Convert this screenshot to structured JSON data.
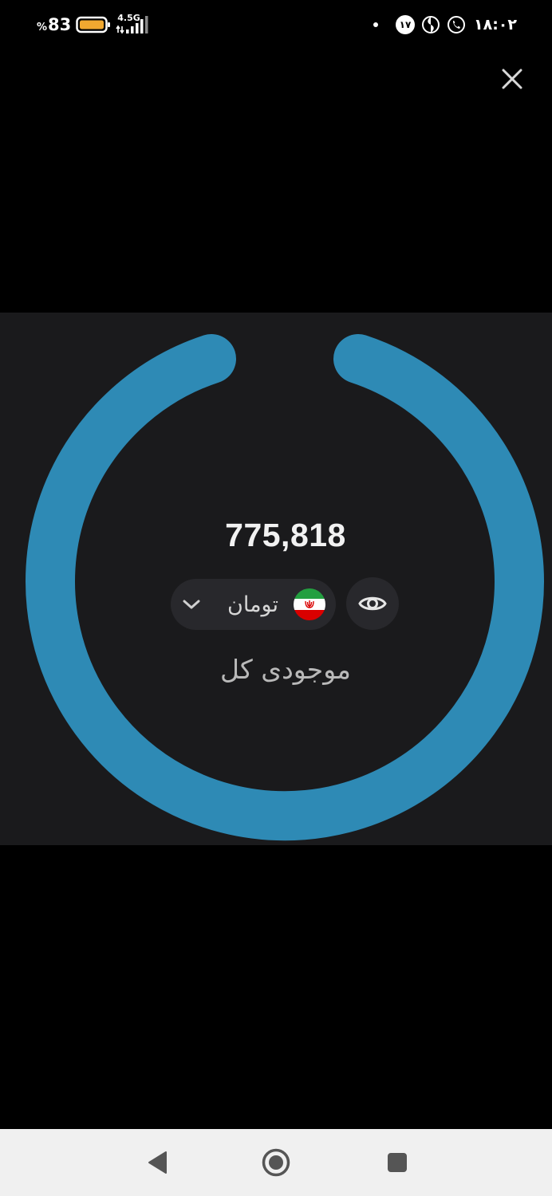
{
  "status_bar": {
    "battery_percent": "83",
    "percent_sign": "%",
    "network_type": "4.5G",
    "notification_count": "۱۷",
    "time": "۱۸:۰۲",
    "battery_color": "#f0a830"
  },
  "close_button": {
    "icon": "close-icon"
  },
  "wallet": {
    "balance": "775,818",
    "currency": "تومان",
    "currency_flag": "iran-flag-icon",
    "caption": "موجودی کل",
    "ring_color": "#2e8ab5",
    "visibility_icon": "eye-icon"
  },
  "navigation": {
    "back_icon": "back-icon",
    "home_icon": "home-icon",
    "recents_icon": "recents-icon"
  }
}
